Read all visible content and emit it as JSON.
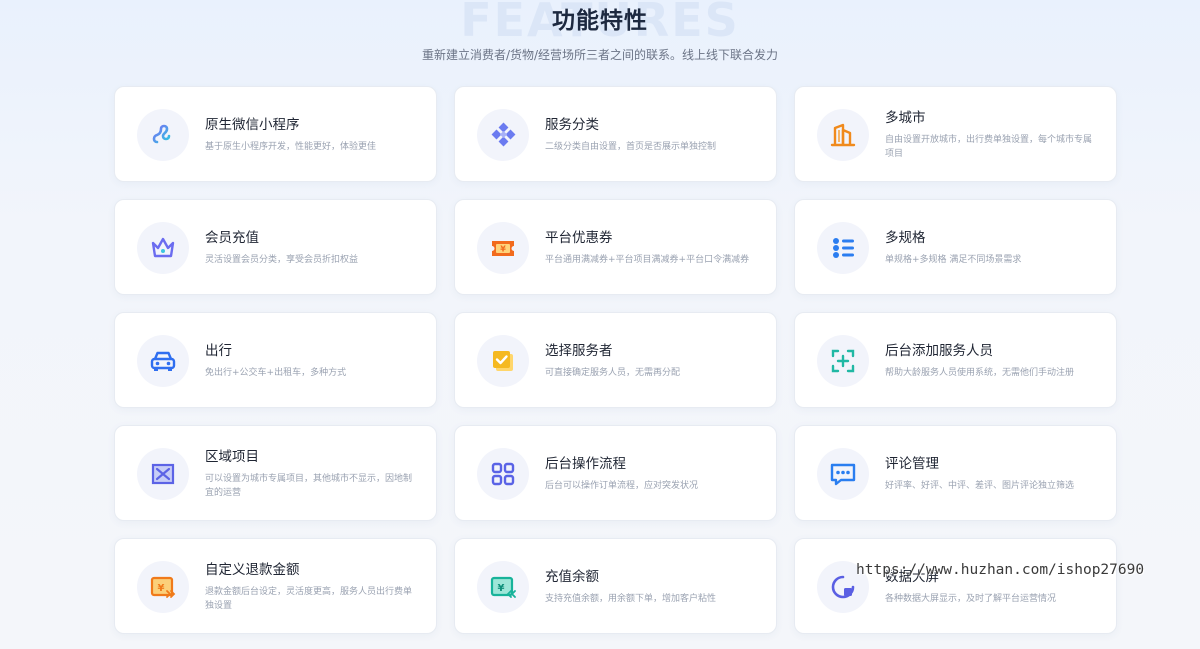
{
  "header": {
    "bg_word": "FEATURES",
    "title": "功能特性",
    "subtitle": "重新建立消费者/货物/经营场所三者之间的联系。线上线下联合发力"
  },
  "features": [
    {
      "title": "原生微信小程序",
      "desc": "基于原生小程序开发，性能更好，体验更佳",
      "icon": "miniprogram-icon"
    },
    {
      "title": "服务分类",
      "desc": "二级分类自由设置，首页是否展示单独控制",
      "icon": "category-icon"
    },
    {
      "title": "多城市",
      "desc": "自由设置开放城市，出行费单独设置，每个城市专属项目",
      "icon": "city-icon"
    },
    {
      "title": "会员充值",
      "desc": "灵活设置会员分类，享受会员折扣权益",
      "icon": "crown-icon"
    },
    {
      "title": "平台优惠券",
      "desc": "平台通用满减券+平台项目满减券+平台口令满减券",
      "icon": "coupon-icon"
    },
    {
      "title": "多规格",
      "desc": "单规格+多规格 满足不同场景需求",
      "icon": "spec-list-icon"
    },
    {
      "title": "出行",
      "desc": "免出行+公交车+出租车，多种方式",
      "icon": "car-icon"
    },
    {
      "title": "选择服务者",
      "desc": "可直接确定服务人员，无需再分配",
      "icon": "select-check-icon"
    },
    {
      "title": "后台添加服务人员",
      "desc": "帮助大龄服务人员使用系统，无需他们手动注册",
      "icon": "add-person-icon"
    },
    {
      "title": "区域项目",
      "desc": "可以设置为城市专属项目，其他城市不显示，因地制宜的运营",
      "icon": "region-icon"
    },
    {
      "title": "后台操作流程",
      "desc": "后台可以操作订单流程，应对突发状况",
      "icon": "grid-apps-icon"
    },
    {
      "title": "评论管理",
      "desc": "好评率、好评、中评、差评、图片评论独立筛选",
      "icon": "comment-icon"
    },
    {
      "title": "自定义退款金额",
      "desc": "退款金额后台设定，灵活度更高，服务人员出行费单独设置",
      "icon": "refund-icon"
    },
    {
      "title": "充值余额",
      "desc": "支持充值余额，用余额下单，增加客户粘性",
      "icon": "recharge-icon"
    },
    {
      "title": "数据大屏",
      "desc": "各种数据大屏显示，及时了解平台运营情况",
      "icon": "data-screen-icon"
    }
  ],
  "watermark": "https://www.huzhan.com/ishop27690",
  "colors": {
    "title": "#1d2940",
    "subtitle": "#6b7486",
    "card_bg": "#ffffff",
    "icon_bg": "#f2f4fb",
    "desc": "#9aa2b1"
  }
}
